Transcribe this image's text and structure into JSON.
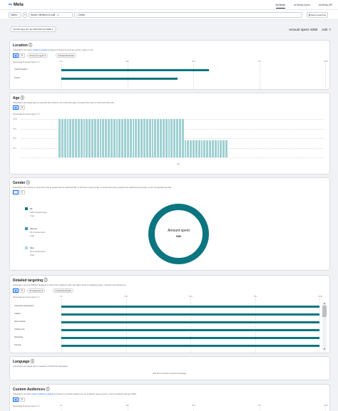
{
  "app": {
    "logo_mark": "∞",
    "logo_text": "Meta"
  },
  "topnav": [
    "Ad library",
    "Ad library report",
    "Ad library API"
  ],
  "filters": {
    "country": "India",
    "category": "Issues, elections or polit...",
    "search_value": "Cindia",
    "saved_searches": "Saved searches"
  },
  "date_range": "Last 90 days (27 Jan 2020-26 Feb 2020)",
  "totals": {
    "amount_spent": "Amount spent: €280",
    "ads": "Ads: 7"
  },
  "location": {
    "title": "Location",
    "desc_pre": "Advertisers can reach ",
    "desc_link": "audience locations",
    "desc_post": " based on locations such as country, region or city.",
    "filter_type": "All amount types",
    "filter_toggles": "Included  Excluded",
    "chart_label": "Percentage of amount spent",
    "ticks": [
      "0%",
      "25%",
      "50%",
      "75%",
      "100%"
    ],
    "rows": [
      {
        "name": "United Kingdom",
        "value": 56
      },
      {
        "name": "France",
        "value": 44
      }
    ]
  },
  "age": {
    "title": "Age",
    "desc": "Advertisers can target age by selecting the minimum and maximum age of people they want to reach with their ads.",
    "chart_label": "Percentage of amount spent",
    "y_ticks": [
      "100%",
      "75%",
      "50%",
      "25%"
    ],
    "x_label": "Age",
    "bars": [
      100,
      100,
      100,
      100,
      100,
      100,
      100,
      100,
      100,
      100,
      100,
      100,
      100,
      100,
      100,
      100,
      100,
      100,
      100,
      100,
      100,
      100,
      100,
      100,
      100,
      100,
      100,
      100,
      100,
      100,
      100,
      100,
      100,
      100,
      100,
      100,
      100,
      100,
      100,
      100,
      100,
      100,
      100,
      100,
      100,
      100,
      45,
      45,
      45,
      45,
      45,
      45,
      45,
      45,
      45,
      45,
      45,
      45,
      45,
      45,
      45,
      45
    ]
  },
  "gender": {
    "title": "Gender",
    "desc": "Advertisers can choose to show their ads to people who've selected Man or Woman in their profile, or show their ads to people who selected any gender or are not specified gender.",
    "legend": [
      {
        "name": "All",
        "pct": "100% of amount spent",
        "ads": "7 ads",
        "color": "#0b7580"
      },
      {
        "name": "Women",
        "pct": "0% of amount spent",
        "ads": "0 ads",
        "color": "#3f8fb8"
      },
      {
        "name": "Men",
        "pct": "0% of amount spent",
        "ads": "0 ads",
        "color": "#a8d4ee"
      }
    ],
    "donut_title": "Amount spent",
    "donut_value": "€280"
  },
  "detailed": {
    "title": "Detailed targeting",
    "desc": "Advertisers can use detailed targeting to refine their audience with information such as targeting topics, interests and behaviours.",
    "filter_type": "All categories",
    "filter_toggles": "Included  Excluded",
    "chart_label": "Percentage of amount spent",
    "ticks": [
      "0%",
      "25%",
      "50%",
      "75%",
      "100%"
    ],
    "rows": [
      {
        "name": "Champion (sportswear)",
        "value": 100
      },
      {
        "name": "Clothes",
        "value": 100
      },
      {
        "name": "Street fashion",
        "value": 100
      },
      {
        "name": "Clothing (Ap",
        "value": 100
      },
      {
        "name": "Streetwear",
        "value": 100
      },
      {
        "name": "Camera",
        "value": 100
      }
    ]
  },
  "language": {
    "title": "Language",
    "desc": "Advertisers can target ads to speakers of particular languages.",
    "empty": "Ads did not select a specific language."
  },
  "custom": {
    "title": "Custom Audiences",
    "desc_pre": "Advertisers can add ",
    "desc_link": "custom audience settings",
    "desc_post": " to include or exclude people from an audience using sources, such as website and app traffic.",
    "chart_label": "Percentage of amount spent",
    "ticks": [
      "0%",
      "25%",
      "50%",
      "75%",
      "100%"
    ]
  }
}
